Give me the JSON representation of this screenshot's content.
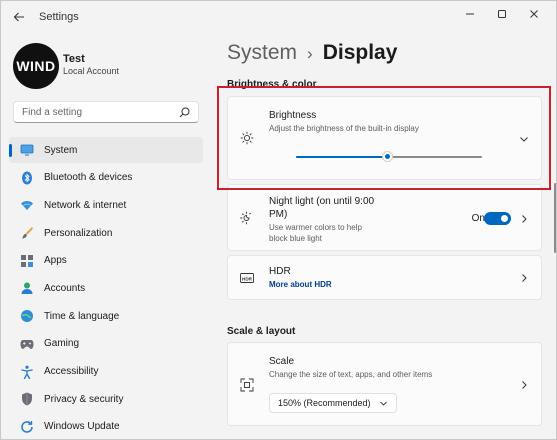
{
  "window": {
    "title": "Settings",
    "controls": {
      "minimize": "—",
      "maximize": "☐",
      "close": "✕"
    }
  },
  "user": {
    "avatar_text": "WIND",
    "name": "Test",
    "account_type": "Local Account"
  },
  "search": {
    "placeholder": "Find a setting"
  },
  "sidebar": {
    "items": [
      {
        "label": "System",
        "icon": "system-icon",
        "selected": true
      },
      {
        "label": "Bluetooth & devices",
        "icon": "bluetooth-icon"
      },
      {
        "label": "Network & internet",
        "icon": "wifi-icon"
      },
      {
        "label": "Personalization",
        "icon": "paintbrush-icon"
      },
      {
        "label": "Apps",
        "icon": "apps-icon"
      },
      {
        "label": "Accounts",
        "icon": "person-icon"
      },
      {
        "label": "Time & language",
        "icon": "globe-clock-icon"
      },
      {
        "label": "Gaming",
        "icon": "gamepad-icon"
      },
      {
        "label": "Accessibility",
        "icon": "accessibility-icon"
      },
      {
        "label": "Privacy & security",
        "icon": "shield-icon"
      },
      {
        "label": "Windows Update",
        "icon": "update-icon"
      }
    ]
  },
  "breadcrumb": {
    "parent": "System",
    "separator": "›",
    "current": "Display"
  },
  "sections": {
    "brightness_color": "Brightness & color",
    "scale_layout": "Scale & layout"
  },
  "brightness": {
    "title": "Brightness",
    "description": "Adjust the brightness of the built-in display",
    "value_fraction": 0.49,
    "icon": "sun-icon"
  },
  "night_light": {
    "title_line1": "Night light (on until 9:00",
    "title_line2": "PM)",
    "desc_line1": "Use warmer colors to help",
    "desc_line2": "block blue light",
    "toggle_label": "On",
    "toggle_on": true,
    "icon": "night-light-icon"
  },
  "hdr": {
    "title": "HDR",
    "link": "More about HDR",
    "icon": "hdr-icon"
  },
  "scale": {
    "title": "Scale",
    "description": "Change the size of text, apps, and other items",
    "selected": "150% (Recommended)",
    "icon": "scale-icon"
  },
  "colors": {
    "accent": "#0067c0",
    "highlight": "#c8202c",
    "background": "#f3f3f3",
    "card": "#fbfbfb"
  }
}
